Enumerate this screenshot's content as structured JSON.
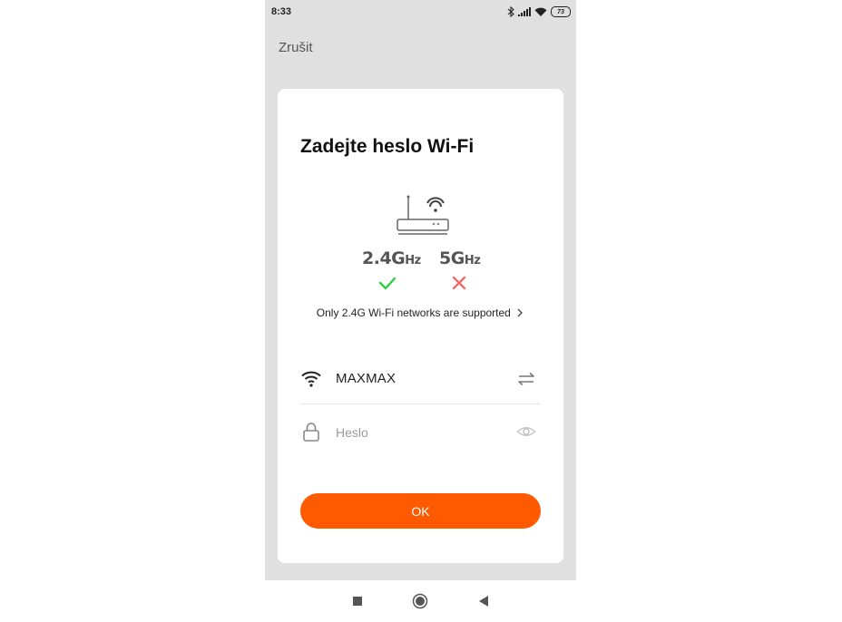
{
  "status_bar": {
    "time": "8:33",
    "battery": "73",
    "icons": [
      "bluetooth-icon",
      "signal-icon",
      "wifi-icon",
      "battery-icon"
    ]
  },
  "header": {
    "cancel_label": "Zrušit"
  },
  "card": {
    "title": "Zadejte heslo Wi-Fi",
    "bands": {
      "band_24_main": "2.4G",
      "band_24_unit": "Hz",
      "band_5_main": "5G",
      "band_5_unit": "Hz",
      "band_24_supported": true,
      "band_5_supported": false
    },
    "support_note": "Only 2.4G Wi-Fi networks are supported",
    "network": {
      "ssid": "MAXMAX"
    },
    "password": {
      "value": "",
      "placeholder": "Heslo"
    },
    "ok_label": "OK"
  },
  "colors": {
    "accent": "#ff5a00",
    "check": "#2ecc40",
    "cross": "#f26b6b",
    "background": "#e0e0e0"
  },
  "navbar": {
    "buttons": [
      "recent-apps-icon",
      "home-icon",
      "back-icon"
    ]
  }
}
